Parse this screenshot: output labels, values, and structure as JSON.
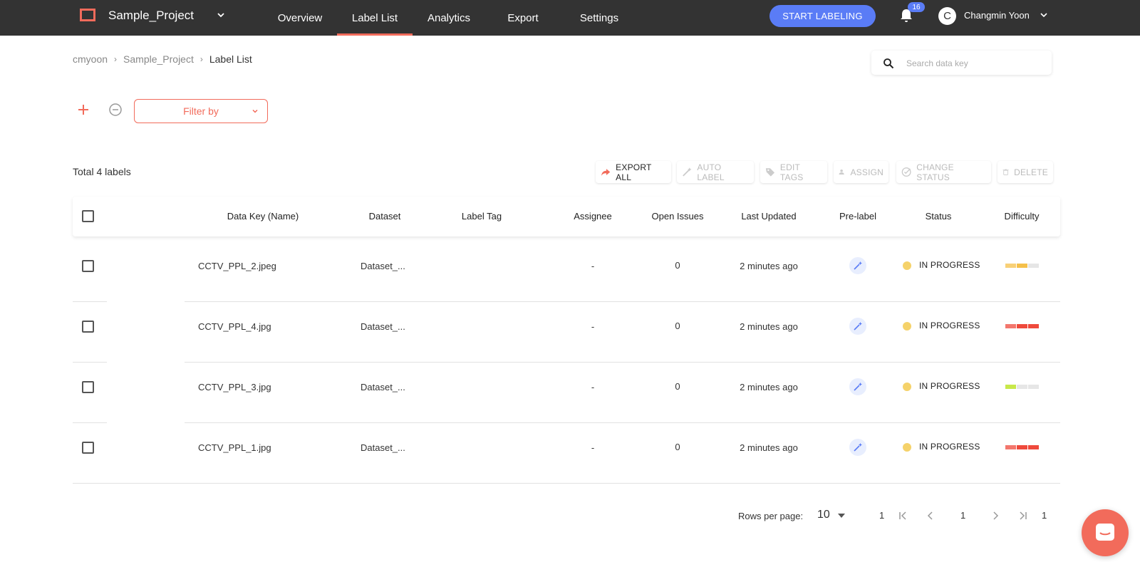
{
  "header": {
    "project_name": "Sample_Project",
    "nav": [
      {
        "label": "Overview",
        "active": false
      },
      {
        "label": "Label List",
        "active": true
      },
      {
        "label": "Analytics",
        "active": false
      },
      {
        "label": "Export",
        "active": false
      },
      {
        "label": "Settings",
        "active": false
      }
    ],
    "start_button": "START LABELING",
    "notification_count": "16",
    "user_initial": "C",
    "user_name": "Changmin Yoon"
  },
  "breadcrumb": [
    "cmyoon",
    "Sample_Project",
    "Label List"
  ],
  "breadcrumb_separator": "›",
  "search": {
    "placeholder": "Search data key",
    "value": ""
  },
  "filter": {
    "label": "Filter by"
  },
  "total_text": "Total 4 labels",
  "actions": [
    {
      "label": "EXPORT ALL",
      "icon": "share-arrow-icon",
      "enabled": true
    },
    {
      "label": "AUTO LABEL",
      "icon": "magic-wand-icon",
      "enabled": false
    },
    {
      "label": "EDIT TAGS",
      "icon": "tag-icon",
      "enabled": false
    },
    {
      "label": "ASSIGN",
      "icon": "assign-user-icon",
      "enabled": false
    },
    {
      "label": "CHANGE STATUS",
      "icon": "check-circle-icon",
      "enabled": false
    },
    {
      "label": "DELETE",
      "icon": "trash-icon",
      "enabled": false
    }
  ],
  "table": {
    "columns": [
      "Data Key (Name)",
      "Dataset",
      "Label Tag",
      "Assignee",
      "Open Issues",
      "Last Updated",
      "Pre-label",
      "Status",
      "Difficulty"
    ],
    "rows": [
      {
        "data_key": "CCTV_PPL_2.jpeg",
        "dataset": "Dataset_...",
        "label_tag": "",
        "assignee": "-",
        "open_issues": "0",
        "last_updated": "2 minutes ago",
        "status": "IN PROGRESS",
        "difficulty": 2,
        "difficulty_color": "#f5c04a"
      },
      {
        "data_key": "CCTV_PPL_4.jpg",
        "dataset": "Dataset_...",
        "label_tag": "",
        "assignee": "-",
        "open_issues": "0",
        "last_updated": "2 minutes ago",
        "status": "IN PROGRESS",
        "difficulty": 3,
        "difficulty_color": "#ef4a3c"
      },
      {
        "data_key": "CCTV_PPL_3.jpg",
        "dataset": "Dataset_...",
        "label_tag": "",
        "assignee": "-",
        "open_issues": "0",
        "last_updated": "2 minutes ago",
        "status": "IN PROGRESS",
        "difficulty": 1,
        "difficulty_color": "#c8e84a"
      },
      {
        "data_key": "CCTV_PPL_1.jpg",
        "dataset": "Dataset_...",
        "label_tag": "",
        "assignee": "-",
        "open_issues": "0",
        "last_updated": "2 minutes ago",
        "status": "IN PROGRESS",
        "difficulty": 3,
        "difficulty_color": "#ef4a3c"
      }
    ]
  },
  "pagination": {
    "rows_per_page_label": "Rows per page:",
    "rows_per_page": "10",
    "from": "1",
    "current": "1",
    "total_pages": "1"
  },
  "colors": {
    "accent": "#f26b5b",
    "primary": "#5a7cf6",
    "status_in_progress": "#f5d26a",
    "header_bg": "#333333"
  }
}
